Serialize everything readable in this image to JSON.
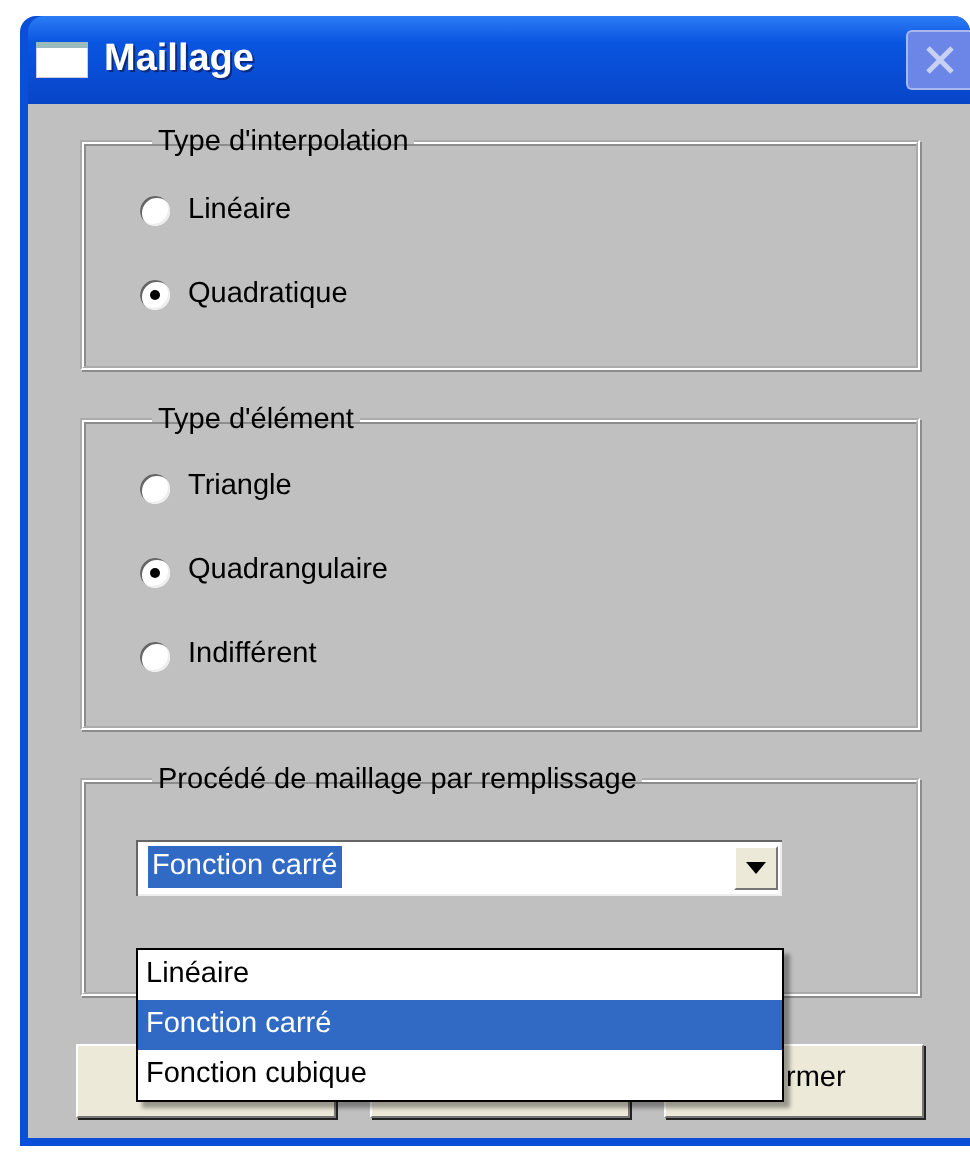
{
  "window": {
    "title": "Maillage"
  },
  "groups": [
    {
      "title": "Type d'interpolation",
      "options": [
        {
          "label": "Linéaire",
          "selected": false
        },
        {
          "label": "Quadratique",
          "selected": true
        }
      ]
    },
    {
      "title": "Type d'élément",
      "options": [
        {
          "label": "Triangle",
          "selected": false
        },
        {
          "label": "Quadrangulaire",
          "selected": true
        },
        {
          "label": "Indifférent",
          "selected": false
        }
      ]
    }
  ],
  "fill_group": {
    "title": "Procédé de maillage par remplissage",
    "combo": {
      "value": "Fonction carré"
    },
    "list": [
      {
        "label": "Linéaire",
        "selected": false
      },
      {
        "label": "Fonction carré",
        "selected": true
      },
      {
        "label": "Fonction cubique",
        "selected": false
      }
    ]
  },
  "buttons": [
    {
      "kind": "plain"
    },
    {
      "kind": "plain"
    },
    {
      "kind": "plain",
      "label": "rmer"
    }
  ]
}
